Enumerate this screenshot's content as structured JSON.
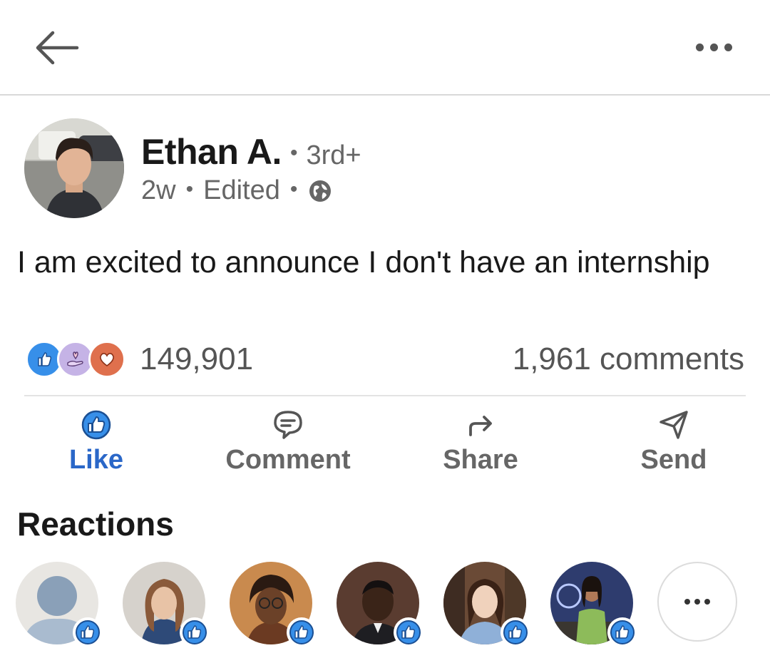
{
  "header": {
    "back_icon": "arrow-left-icon",
    "more_icon": "more-horizontal-icon"
  },
  "post": {
    "author_name": "Ethan A.",
    "connection_degree": "3rd+",
    "time_ago": "2w",
    "edited_label": "Edited",
    "visibility_icon": "globe-icon",
    "text": "I am excited to announce I don't have an internship",
    "reaction_types": [
      "like",
      "support",
      "love"
    ],
    "reaction_count": "149,901",
    "comments_label": "1,961 comments"
  },
  "actions": [
    {
      "label": "Like",
      "icon": "like-icon",
      "active": true
    },
    {
      "label": "Comment",
      "icon": "comment-icon"
    },
    {
      "label": "Share",
      "icon": "share-icon"
    },
    {
      "label": "Send",
      "icon": "send-icon"
    }
  ],
  "reactions_section": {
    "heading": "Reactions",
    "reactors": [
      {
        "avatar": "default-avatar",
        "reaction": "like"
      },
      {
        "avatar": "photo-avatar",
        "reaction": "like"
      },
      {
        "avatar": "photo-avatar",
        "reaction": "like"
      },
      {
        "avatar": "photo-avatar",
        "reaction": "like"
      },
      {
        "avatar": "photo-avatar",
        "reaction": "like"
      },
      {
        "avatar": "photo-avatar",
        "reaction": "like"
      }
    ],
    "more_icon": "more-horizontal-icon"
  },
  "colors": {
    "accent": "#2a67c8",
    "like_blue": "#378fe9",
    "love_orange": "#df704d",
    "support_purple": "#c5b3e6",
    "muted_text": "#666666"
  }
}
